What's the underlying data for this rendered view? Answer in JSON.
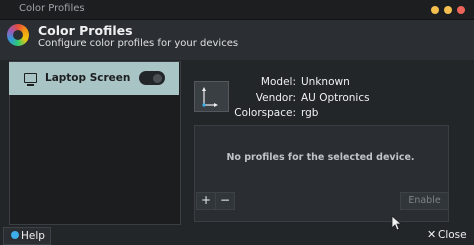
{
  "window": {
    "title": "Color Profiles"
  },
  "header": {
    "title": "Color Profiles",
    "subtitle": "Configure color profiles for your devices"
  },
  "devices": [
    {
      "label": "Laptop Screen",
      "selected": true,
      "enabled": true
    }
  ],
  "details": {
    "model_label": "Model:",
    "model_value": "Unknown",
    "vendor_label": "Vendor:",
    "vendor_value": "AU Optronics",
    "colorspace_label": "Colorspace:",
    "colorspace_value": "rgb"
  },
  "profiles": {
    "empty_message": "No profiles for the selected device."
  },
  "toolbar": {
    "add_label": "+",
    "remove_label": "−",
    "enable_label": "Enable"
  },
  "footer": {
    "help_label": "Help",
    "close_label": "Close"
  },
  "colors": {
    "selection": "#a9c4c5",
    "accent": "#3daee9",
    "background": "#232629"
  }
}
